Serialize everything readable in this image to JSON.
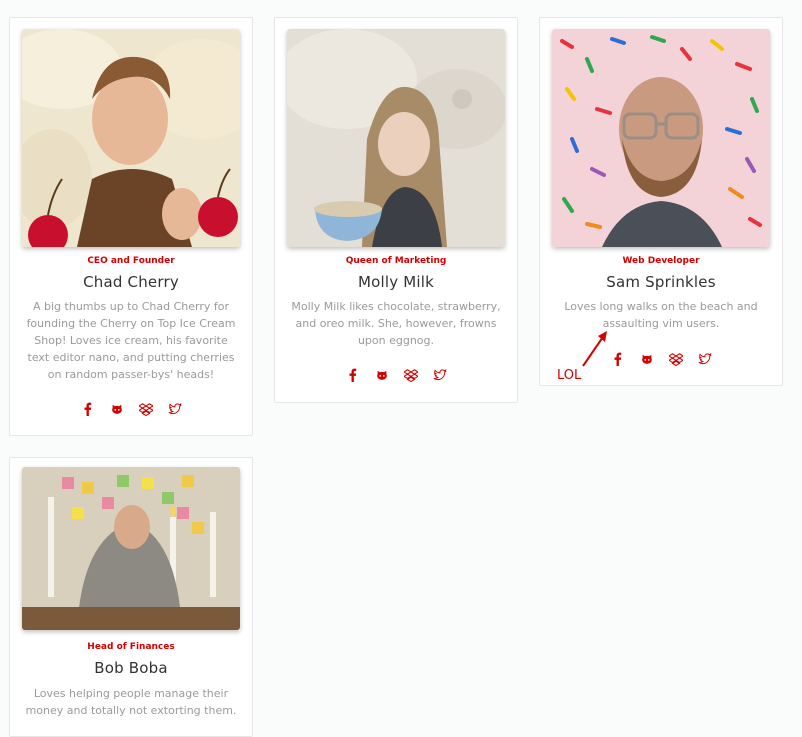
{
  "accent_color": "#d40000",
  "team": [
    {
      "role": "CEO and Founder",
      "name": "Chad Cherry",
      "bio": "A big thumbs up to Chad Cherry for founding the Cherry on Top Ice Cream Shop! Loves ice cream, his favorite text editor nano, and putting cherries on random passer-bys' heads!",
      "photo_description": "man giving thumbs up with whipped cream background and cherries"
    },
    {
      "role": "Queen of Marketing",
      "name": "Molly Milk",
      "bio": "Molly Milk likes chocolate, strawberry, and oreo milk. She, however, frowns upon eggnog.",
      "photo_description": "woman eating cereal with milk background"
    },
    {
      "role": "Web Developer",
      "name": "Sam Sprinkles",
      "bio": "Loves long walks on the beach and assaulting vim users.",
      "photo_description": "bearded man with glasses on sprinkles background"
    },
    {
      "role": "Head of Finances",
      "name": "Bob Boba",
      "bio": "Loves helping people manage their money and totally not extorting them.",
      "photo_description": "man in hood at table with candles and sticky notes"
    }
  ],
  "social_icons": [
    "facebook-icon",
    "github-icon",
    "dropbox-icon",
    "twitter-icon"
  ],
  "annotation": {
    "label": "LOL"
  }
}
